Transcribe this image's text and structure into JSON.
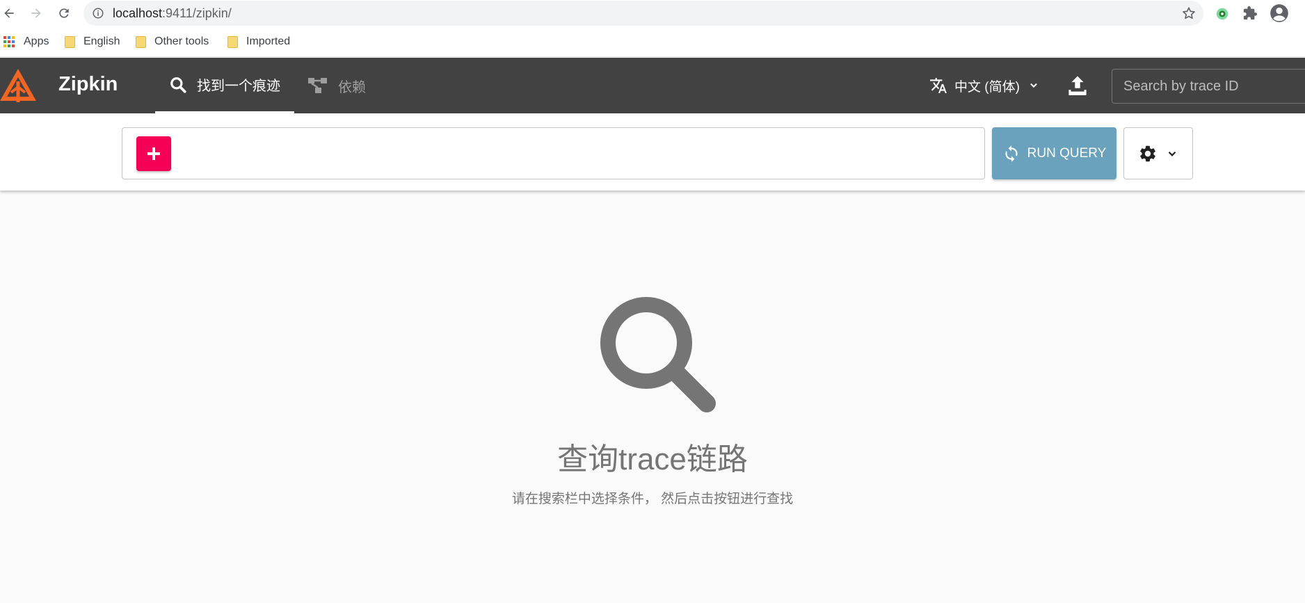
{
  "browser": {
    "url_host": "localhost",
    "url_path": ":9411/zipkin/",
    "bookmarks": [
      {
        "label": "Apps"
      },
      {
        "label": "English"
      },
      {
        "label": "Other tools"
      },
      {
        "label": "Imported"
      }
    ]
  },
  "header": {
    "brand": "Zipkin",
    "tabs": [
      {
        "label": "找到一个痕迹",
        "icon": "search-icon",
        "active": true
      },
      {
        "label": "依赖",
        "icon": "dependencies-icon",
        "active": false
      }
    ],
    "language": "中文 (简体)",
    "trace_search_placeholder": "Search by trace ID"
  },
  "query": {
    "run_label": "RUN QUERY"
  },
  "empty_state": {
    "title": "查询trace链路",
    "subtitle": "请在搜索栏中选择条件， 然后点击按钮进行查找"
  },
  "colors": {
    "header_bg": "#424242",
    "add_button": "#f50057",
    "run_button": "#6aa2bd",
    "logo": "#f26522"
  }
}
